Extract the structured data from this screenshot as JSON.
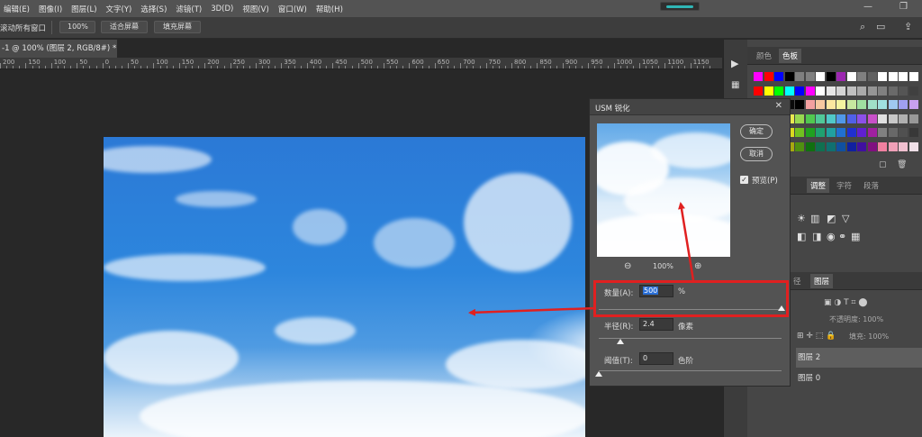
{
  "menubar": {
    "items": [
      "编辑(E)",
      "图像(I)",
      "图层(L)",
      "文字(Y)",
      "选择(S)",
      "滤镜(T)",
      "3D(D)",
      "视图(V)",
      "窗口(W)",
      "帮助(H)"
    ],
    "window_controls": [
      "—",
      "❐"
    ]
  },
  "options_bar": {
    "scroll_all_label": "滚动所有窗口",
    "zoom_100": "100%",
    "fit_screen": "适合屏幕",
    "fill_screen": "填充屏幕"
  },
  "document": {
    "tab_title": "-1 @ 100% (图层 2, RGB/8#) *"
  },
  "ruler": {
    "labels": [
      "200",
      "150",
      "100",
      "50",
      "0",
      "50",
      "100",
      "150",
      "200",
      "250",
      "300",
      "350",
      "400",
      "450",
      "500",
      "550",
      "600",
      "650",
      "700",
      "750",
      "800",
      "850",
      "900",
      "950",
      "1000",
      "1050",
      "1100",
      "1150"
    ]
  },
  "panels": {
    "color_tabs": [
      "颜色",
      "色板"
    ],
    "adjust_tabs": [
      "调整",
      "字符",
      "段落"
    ],
    "layers_tabs": [
      "径",
      "图层"
    ],
    "opacity_label": "不透明度: 100%",
    "fill_label": "填充: 100%",
    "layers": [
      "图层 2",
      "图层 0"
    ],
    "swatch_rows": [
      [
        "#ff00ff",
        "#ff0000",
        "#0000ff",
        "#000000",
        "#808080",
        "#808080",
        "#ffffff",
        "#000000",
        "#9c27b0",
        "#ffffff",
        "#808080",
        "#606060",
        "#ffffff",
        "#ffffff",
        "#ffffff",
        "#ffffff"
      ],
      [
        "#ff0000",
        "#ffff00",
        "#00ff00",
        "#00ffff",
        "#0000ff",
        "#ff00ff",
        "#ffffff",
        "#e6e6e6",
        "#d4d4d4",
        "#c0c0c0",
        "#aaaaaa",
        "#959595",
        "#808080",
        "#6a6a6a",
        "#555555",
        "#404040"
      ],
      [
        "#3a3a3a",
        "#2a2a2a",
        "#1a1a1a",
        "#0a0a0a",
        "#000000",
        "#f4a0a0",
        "#f7c8a0",
        "#fbe7a0",
        "#f4f4a0",
        "#c8e8a0",
        "#a0e0a0",
        "#a0e0c8",
        "#a0e0e0",
        "#a0c8f0",
        "#a0a0f0",
        "#c8a0f0"
      ],
      [
        "#f06060",
        "#f08c50",
        "#f0c850",
        "#e8e850",
        "#98d850",
        "#50c850",
        "#50c898",
        "#50c8c8",
        "#5098e8",
        "#5060e8",
        "#8c50e8",
        "#c850c8",
        "#e0e0e0",
        "#c8c8c8",
        "#b0b0b0",
        "#989898"
      ],
      [
        "#e03030",
        "#e06020",
        "#e0a020",
        "#d8d820",
        "#70c020",
        "#20a020",
        "#20a070",
        "#20a0a0",
        "#2070d0",
        "#2030d0",
        "#6020d0",
        "#a020a0",
        "#808080",
        "#686868",
        "#505050",
        "#383838"
      ],
      [
        "#b02020",
        "#b04010",
        "#b07010",
        "#a8a810",
        "#509010",
        "#107010",
        "#107050",
        "#107070",
        "#1050a0",
        "#1020a0",
        "#4010a0",
        "#801080",
        "#f080a0",
        "#f0a0b8",
        "#f0c0d0",
        "#f0e0e8"
      ]
    ]
  },
  "dialog": {
    "title": "USM 锐化",
    "close": "✕",
    "ok": "确定",
    "cancel": "取消",
    "preview_label": "预览(P)",
    "preview_checked": true,
    "zoom_percent": "100%",
    "amount": {
      "label": "数量(A):",
      "value": "500",
      "unit": "%"
    },
    "radius": {
      "label": "半径(R):",
      "value": "2.4",
      "unit": "像素"
    },
    "threshold": {
      "label": "阈值(T):",
      "value": "0",
      "unit": "色阶"
    },
    "slider_levels": {
      "amount": 1.0,
      "radius": 0.12,
      "threshold": 0.0
    }
  },
  "annotation": {
    "box_color": "#e02020",
    "arrow_color": "#e02020"
  }
}
